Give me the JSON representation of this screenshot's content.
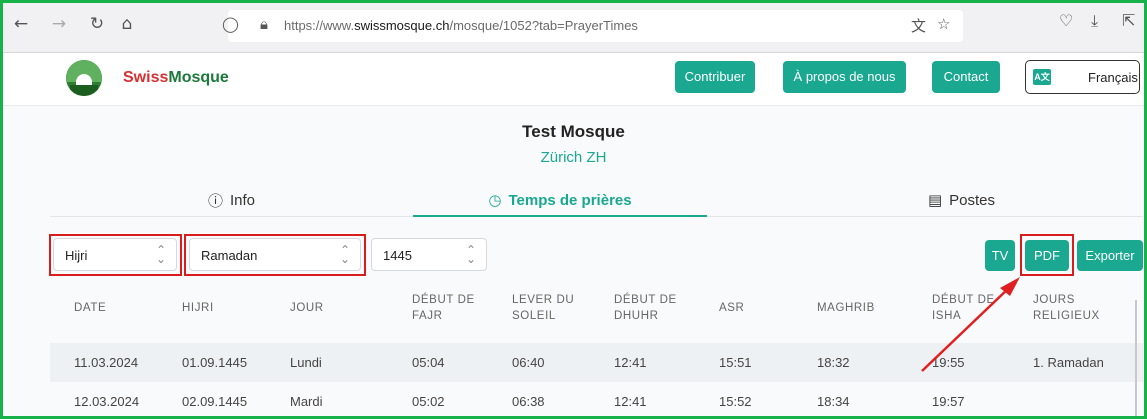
{
  "browser": {
    "url_prefix": "https://www.",
    "url_domain": "swissmosque.ch",
    "url_path": "/mosque/1052?tab=PrayerTimes"
  },
  "header": {
    "brand_part1": "Swiss",
    "brand_part2": "Mosque",
    "nav": {
      "contribute": "Contribuer",
      "about": "À propos de nous",
      "contact": "Contact"
    },
    "language": "Français"
  },
  "mosque": {
    "name": "Test Mosque",
    "city": "Zürich ZH"
  },
  "tabs": {
    "info": "Info",
    "prayer_times": "Temps de prières",
    "posts": "Postes"
  },
  "filters": {
    "calendar": "Hijri",
    "month": "Ramadan",
    "year": "1445"
  },
  "actions": {
    "tv": "TV",
    "pdf": "PDF",
    "export": "Exporter"
  },
  "table": {
    "columns": [
      [
        "DATE"
      ],
      [
        "HIJRI"
      ],
      [
        "JOUR"
      ],
      [
        "DÉBUT DE",
        "FAJR"
      ],
      [
        "LEVER DU",
        "SOLEIL"
      ],
      [
        "DÉBUT DE",
        "DHUHR"
      ],
      [
        "ASR"
      ],
      [
        "MAGHRIB"
      ],
      [
        "DÉBUT DE",
        "ISHA"
      ],
      [
        "JOURS",
        "RELIGIEUX"
      ]
    ],
    "rows": [
      [
        "11.03.2024",
        "01.09.1445",
        "Lundi",
        "05:04",
        "06:40",
        "12:41",
        "15:51",
        "18:32",
        "19:55",
        "1. Ramadan"
      ],
      [
        "12.03.2024",
        "02.09.1445",
        "Mardi",
        "05:02",
        "06:38",
        "12:41",
        "15:52",
        "18:34",
        "19:57",
        ""
      ]
    ]
  },
  "colors": {
    "accent": "#1aa891",
    "highlight": "#d91d1d",
    "frame": "#17b34a"
  }
}
